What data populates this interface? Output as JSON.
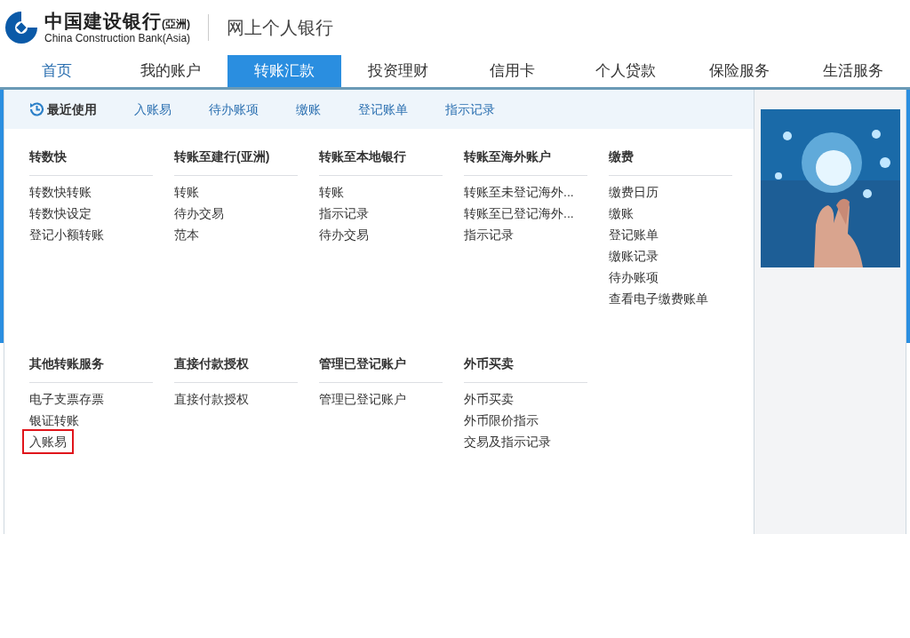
{
  "header": {
    "logo_name": "中国建设银行",
    "logo_region": "(亞洲)",
    "logo_english": "China Construction Bank(Asia)",
    "site_title": "网上个人银行"
  },
  "nav_tabs": [
    {
      "label": "首页",
      "selected": false
    },
    {
      "label": "我的账户",
      "selected": false
    },
    {
      "label": "转账汇款",
      "selected": true
    },
    {
      "label": "投资理财",
      "selected": false
    },
    {
      "label": "信用卡",
      "selected": false
    },
    {
      "label": "个人贷款",
      "selected": false
    },
    {
      "label": "保险服务",
      "selected": false
    },
    {
      "label": "生活服务",
      "selected": false
    }
  ],
  "recent": {
    "title": "最近使用",
    "links": [
      "入账易",
      "待办账项",
      "缴账",
      "登记账单",
      "指示记录"
    ]
  },
  "menu_groups": [
    {
      "title": "转数快",
      "items": [
        {
          "label": "转数快转账",
          "highlighted": false
        },
        {
          "label": "转数快设定",
          "highlighted": false
        },
        {
          "label": "登记小额转账",
          "highlighted": false
        }
      ]
    },
    {
      "title": "转账至建行(亚洲)",
      "items": [
        {
          "label": "转账",
          "highlighted": false
        },
        {
          "label": "待办交易",
          "highlighted": false
        },
        {
          "label": "范本",
          "highlighted": false
        }
      ]
    },
    {
      "title": "转账至本地银行",
      "items": [
        {
          "label": "转账",
          "highlighted": false
        },
        {
          "label": "指示记录",
          "highlighted": false
        },
        {
          "label": "待办交易",
          "highlighted": false
        }
      ]
    },
    {
      "title": "转账至海外账户",
      "items": [
        {
          "label": "转账至未登记海外...",
          "highlighted": false
        },
        {
          "label": "转账至已登记海外...",
          "highlighted": false
        },
        {
          "label": "指示记录",
          "highlighted": false
        }
      ]
    },
    {
      "title": "缴费",
      "items": [
        {
          "label": "缴费日历",
          "highlighted": false
        },
        {
          "label": "缴账",
          "highlighted": false
        },
        {
          "label": "登记账单",
          "highlighted": false
        },
        {
          "label": "缴账记录",
          "highlighted": false
        },
        {
          "label": "待办账项",
          "highlighted": false
        },
        {
          "label": "查看电子缴费账单",
          "highlighted": false
        }
      ]
    },
    {
      "title": "其他转账服务",
      "items": [
        {
          "label": "电子支票存票",
          "highlighted": false
        },
        {
          "label": "银证转账",
          "highlighted": false
        },
        {
          "label": "入账易",
          "highlighted": true
        }
      ]
    },
    {
      "title": "直接付款授权",
      "items": [
        {
          "label": "直接付款授权",
          "highlighted": false
        }
      ]
    },
    {
      "title": "管理已登记账户",
      "items": [
        {
          "label": "管理已登记账户",
          "highlighted": false
        }
      ]
    },
    {
      "title": "外币买卖",
      "items": [
        {
          "label": "外币买卖",
          "highlighted": false
        },
        {
          "label": "外币限价指示",
          "highlighted": false
        },
        {
          "label": "交易及指示记录",
          "highlighted": false
        }
      ]
    }
  ]
}
